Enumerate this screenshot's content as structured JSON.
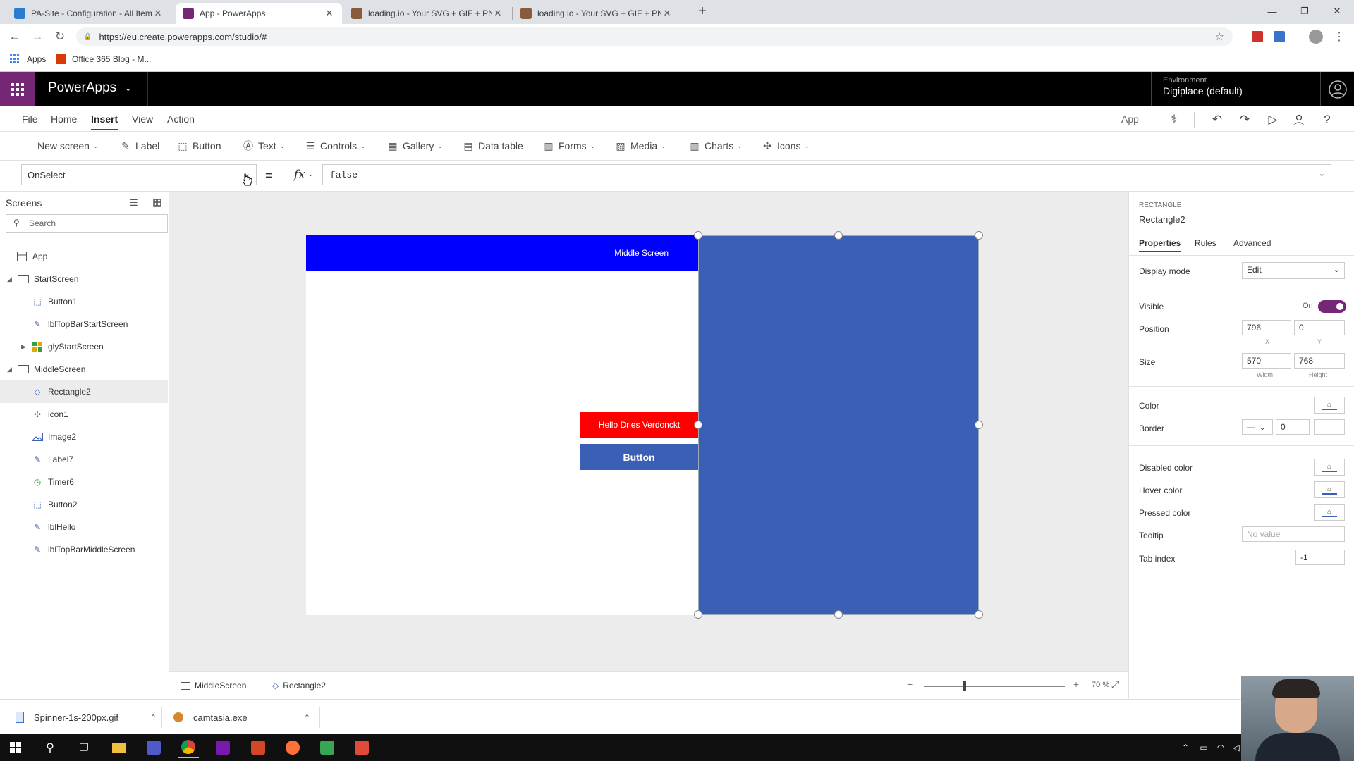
{
  "browser": {
    "tabs": [
      {
        "title": "PA-Site - Configuration - All Items",
        "favicon_color": "#2b7bd1"
      },
      {
        "title": "App - PowerApps",
        "favicon_color": "#742774"
      },
      {
        "title": "loading.io - Your SVG + GIF + PNG",
        "favicon_color": "#8a5a3c"
      },
      {
        "title": "loading.io - Your SVG + GIF + PNG",
        "favicon_color": "#8a5a3c"
      }
    ],
    "url": "https://eu.create.powerapps.com/studio/#",
    "bookmarks": [
      "Apps",
      "Office 365 Blog - M..."
    ]
  },
  "header": {
    "brand": "PowerApps",
    "environment_label": "Environment",
    "environment_value": "Digiplace (default)"
  },
  "menu": {
    "items": [
      "File",
      "Home",
      "Insert",
      "View",
      "Action"
    ],
    "active": "Insert",
    "app_label": "App"
  },
  "ribbon": {
    "items": [
      "New screen",
      "Label",
      "Button",
      "Text",
      "Controls",
      "Gallery",
      "Data table",
      "Forms",
      "Media",
      "Charts",
      "Icons"
    ]
  },
  "formula": {
    "property": "OnSelect",
    "equals": "=",
    "fx": "fx",
    "value": "false"
  },
  "tree": {
    "title": "Screens",
    "search_placeholder": "Search",
    "items": [
      {
        "label": "App",
        "type": "app"
      },
      {
        "label": "StartScreen",
        "type": "screen"
      },
      {
        "label": "Button1",
        "type": "button"
      },
      {
        "label": "lblTopBarStartScreen",
        "type": "label"
      },
      {
        "label": "glyStartScreen",
        "type": "gallery"
      },
      {
        "label": "MiddleScreen",
        "type": "screen"
      },
      {
        "label": "Rectangle2",
        "type": "shape"
      },
      {
        "label": "icon1",
        "type": "icon"
      },
      {
        "label": "Image2",
        "type": "image"
      },
      {
        "label": "Label7",
        "type": "label"
      },
      {
        "label": "Timer6",
        "type": "timer"
      },
      {
        "label": "Button2",
        "type": "button"
      },
      {
        "label": "lblHello",
        "type": "label"
      },
      {
        "label": "lblTopBarMiddleScreen",
        "type": "label"
      }
    ],
    "selected": "Rectangle2"
  },
  "canvas": {
    "topbar_text": "Middle Screen",
    "hello_text": "Hello Dries Verdonckt",
    "button_text": "Button",
    "topbar_color": "#0000ff",
    "hello_color": "#ff0000",
    "rect_color": "#3a5fb5"
  },
  "statusbar": {
    "screen": "MiddleScreen",
    "control": "Rectangle2",
    "zoom": "70",
    "zoom_unit": "%"
  },
  "properties": {
    "type": "RECTANGLE",
    "name": "Rectangle2",
    "tabs": [
      "Properties",
      "Rules",
      "Advanced"
    ],
    "display_mode_label": "Display mode",
    "display_mode_value": "Edit",
    "visible_label": "Visible",
    "visible_state": "On",
    "position_label": "Position",
    "x": "796",
    "y": "0",
    "x_label": "X",
    "y_label": "Y",
    "size_label": "Size",
    "width": "570",
    "height": "768",
    "width_label": "Width",
    "height_label": "Height",
    "color_label": "Color",
    "border_label": "Border",
    "border_width": "0",
    "disabled_color_label": "Disabled color",
    "hover_color_label": "Hover color",
    "pressed_color_label": "Pressed color",
    "tooltip_label": "Tooltip",
    "tooltip_placeholder": "No value",
    "tab_index_label": "Tab index",
    "tab_index_value": "-1"
  },
  "downloads": [
    {
      "name": "Spinner-1s-200px.gif"
    },
    {
      "name": "camtasia.exe"
    }
  ]
}
